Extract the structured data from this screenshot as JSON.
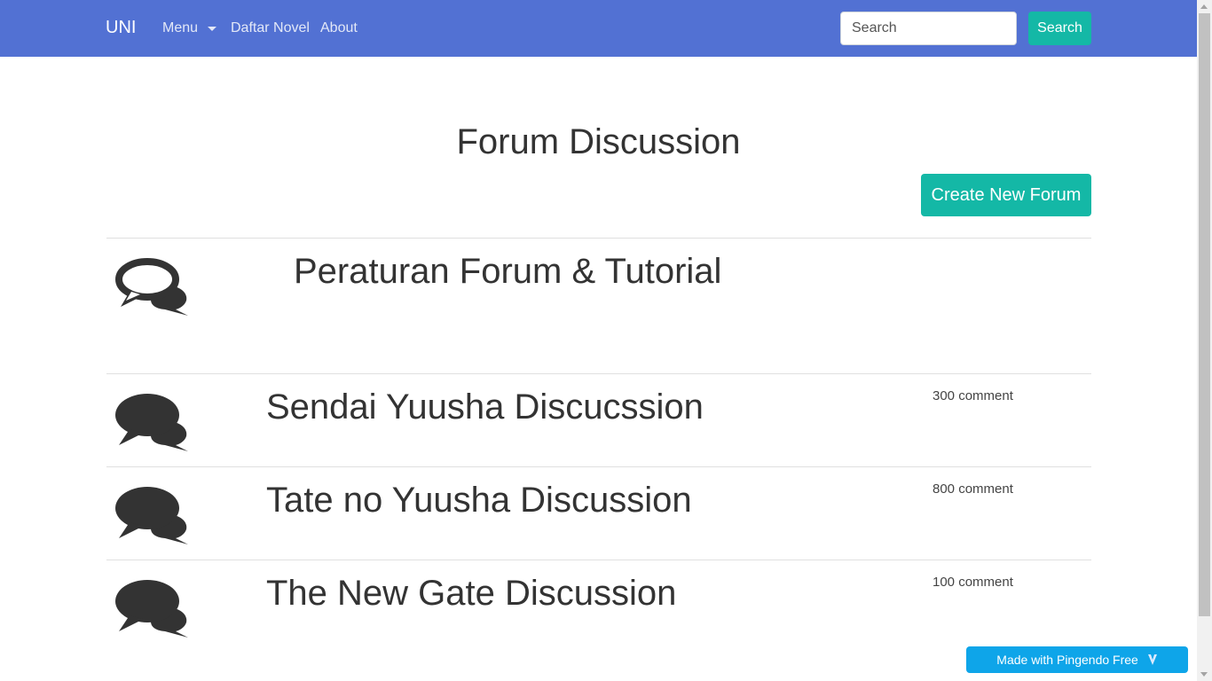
{
  "navbar": {
    "brand": "UNI",
    "items": [
      {
        "label": "Menu"
      },
      {
        "label": "Daftar Novel"
      },
      {
        "label": "About"
      }
    ],
    "search": {
      "placeholder": "Search",
      "button_label": "Search"
    },
    "background_color": "#5271d3"
  },
  "main": {
    "title": "Forum Discussion",
    "create_button_label": "Create New Forum",
    "forums": [
      {
        "title": "Peraturan Forum & Tutorial",
        "comments": "",
        "icon": "comments-outline-icon"
      },
      {
        "title": "Sendai Yuusha Discucssion",
        "comments": "300 comment",
        "icon": "comments-icon"
      },
      {
        "title": "Tate no Yuusha Discussion",
        "comments": "800 comment",
        "icon": "comments-icon"
      },
      {
        "title": "The New Gate Discussion",
        "comments": "100 comment",
        "icon": "comments-icon"
      }
    ]
  },
  "badge": {
    "label": "Made with Pingendo Free"
  },
  "colors": {
    "accent": "#14b8a6",
    "badge": "#0ea5e9",
    "icon": "#333333"
  }
}
